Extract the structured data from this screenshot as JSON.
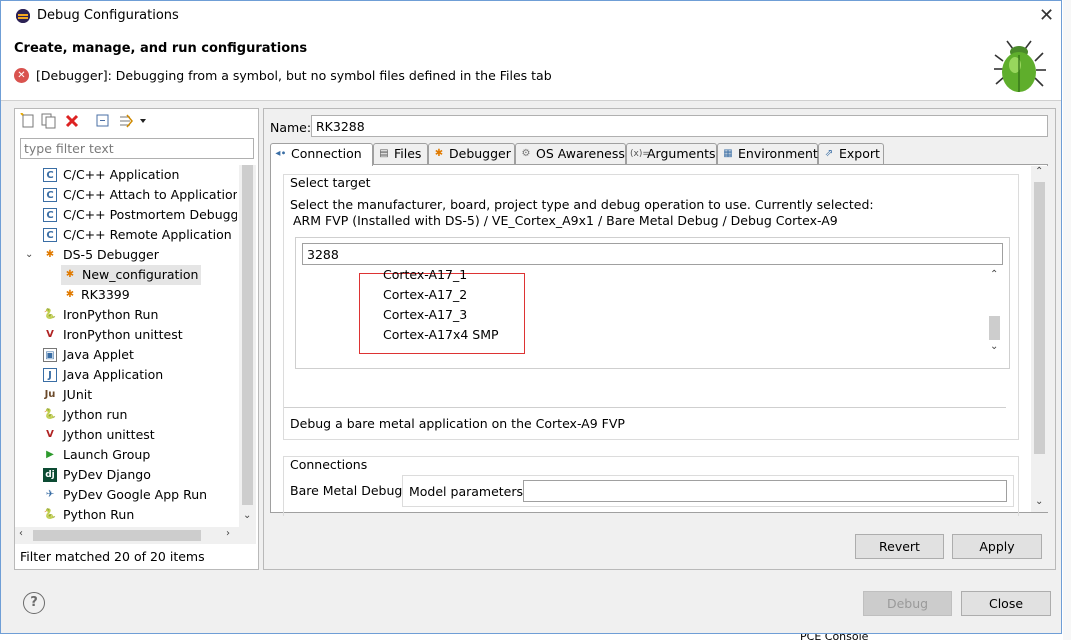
{
  "window": {
    "title": "Debug Configurations",
    "close": "✕"
  },
  "header": {
    "title": "Create, manage, and run configurations",
    "error": "[Debugger]: Debugging from a symbol, but no symbol files defined in the Files tab"
  },
  "left": {
    "filter_placeholder": "type filter text",
    "tree": [
      {
        "label": "C/C++ Application",
        "icon": "c-icon"
      },
      {
        "label": "C/C++ Attach to Application",
        "icon": "c-icon"
      },
      {
        "label": "C/C++ Postmortem Debugger",
        "icon": "c-icon"
      },
      {
        "label": "C/C++ Remote Application",
        "icon": "c-icon"
      },
      {
        "label": "DS-5 Debugger",
        "icon": "ds5-icon",
        "expanded": true
      },
      {
        "label": "New_configuration",
        "icon": "ds5-icon",
        "selected": true,
        "child": true
      },
      {
        "label": "RK3399",
        "icon": "ds5-icon",
        "child": true
      },
      {
        "label": "IronPython Run",
        "icon": "python-icon"
      },
      {
        "label": "IronPython unittest",
        "icon": "python-icon"
      },
      {
        "label": "Java Applet",
        "icon": "applet-icon"
      },
      {
        "label": "Java Application",
        "icon": "java-icon"
      },
      {
        "label": "JUnit",
        "icon": "junit-icon"
      },
      {
        "label": "Jython run",
        "icon": "python-icon"
      },
      {
        "label": "Jython unittest",
        "icon": "python-icon"
      },
      {
        "label": "Launch Group",
        "icon": "launch-icon"
      },
      {
        "label": "PyDev Django",
        "icon": "django-icon"
      },
      {
        "label": "PyDev Google App Run",
        "icon": "google-icon"
      },
      {
        "label": "Python Run",
        "icon": "python-icon"
      }
    ],
    "filter_status": "Filter matched 20 of 20 items"
  },
  "right": {
    "name_label": "Name:",
    "name_value": "RK3288",
    "tabs": [
      {
        "label": "Connection",
        "active": true
      },
      {
        "label": "Files"
      },
      {
        "label": "Debugger"
      },
      {
        "label": "OS Awareness"
      },
      {
        "label": "Arguments"
      },
      {
        "label": "Environment"
      },
      {
        "label": "Export"
      }
    ],
    "select_target": {
      "title": "Select target",
      "desc1": "Select the manufacturer, board, project type and debug operation to use. Currently selected:",
      "desc2": "ARM FVP (Installed with DS-5) / VE_Cortex_A9x1 / Bare Metal Debug / Debug Cortex-A9",
      "search_value": "3288",
      "items": [
        "Cortex-A17_1",
        "Cortex-A17_2",
        "Cortex-A17_3",
        "Cortex-A17x4 SMP"
      ],
      "operation_desc": "Debug a bare metal application on the Cortex-A9 FVP"
    },
    "connections": {
      "title": "Connections",
      "bare_metal_label": "Bare Metal Debug",
      "model_label": "Model parameters",
      "model_value": ""
    },
    "revert_label": "Revert",
    "apply_label": "Apply"
  },
  "footer": {
    "help": "?",
    "debug_label": "Debug",
    "close_label": "Close"
  },
  "background": {
    "console_text": "PCE Console"
  },
  "colors": {
    "selection_bg": "#e5e5e5",
    "highlight_border": "#dd3333",
    "window_border": "#6f9ed6"
  }
}
